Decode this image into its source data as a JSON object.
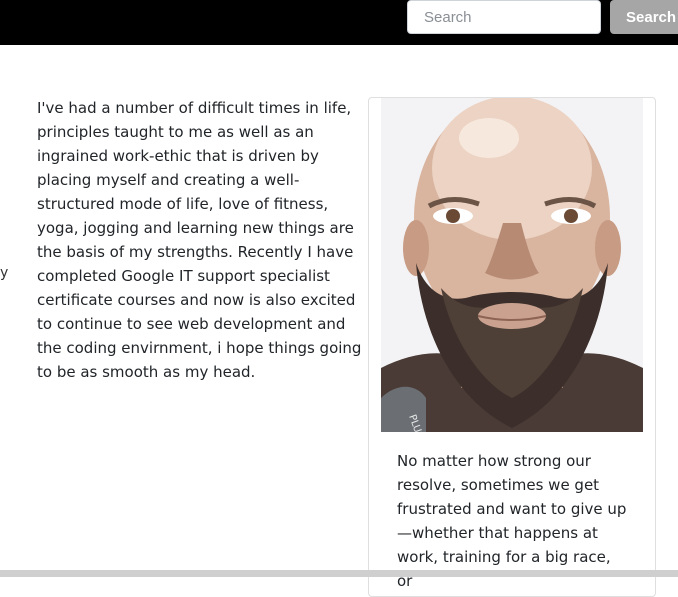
{
  "header": {
    "search_placeholder": "Search",
    "search_button_label": "Search"
  },
  "main": {
    "stray_glyph": "y",
    "about_paragraph": "I've had a number of difficult times in life, principles taught to me as well as an ingrained work-ethic that is driven by placing myself and creating a well-structured mode of life, love of fitness, yoga, jogging and learning new things are the basis of my strengths. Recently I have completed Google IT support specialist certificate courses and now is also excited to continue to see web development and the coding envirnment, i hope things going to be as smooth as my head."
  },
  "card": {
    "quote_text": "No matter how strong our resolve, sometimes we get frustrated and want to give up —whether that happens at work, training for a big race, or",
    "shirt_print_text": "PLUS F"
  },
  "colors": {
    "header_bg": "#000000",
    "search_button_bg": "#a6a6a6",
    "text": "#212529"
  }
}
